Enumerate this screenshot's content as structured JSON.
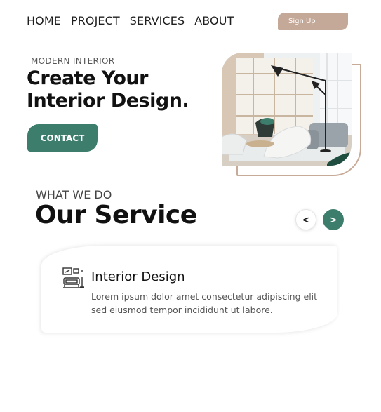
{
  "nav": {
    "items": [
      "HOME",
      "PROJECT",
      "SERVICES",
      "ABOUT"
    ],
    "signup_label": "Sign Up"
  },
  "hero": {
    "eyebrow": "MODERN INTERIOR",
    "title_line1": "Create Your",
    "title_line2": "Interior Design.",
    "contact_label": "CONTACT"
  },
  "services": {
    "eyebrow": "WHAT WE DO",
    "title": "Our Service",
    "prev_label": "<",
    "next_label": ">",
    "card": {
      "title": "Interior Design",
      "description": "Lorem ipsum dolor amet consectetur adipiscing elit sed eiusmod tempor incididunt ut labore."
    }
  },
  "colors": {
    "accent": "#3d7d6c",
    "signup": "#c4a898",
    "frame": "#c7ab98"
  },
  "icons": [
    "living-room-icon"
  ]
}
